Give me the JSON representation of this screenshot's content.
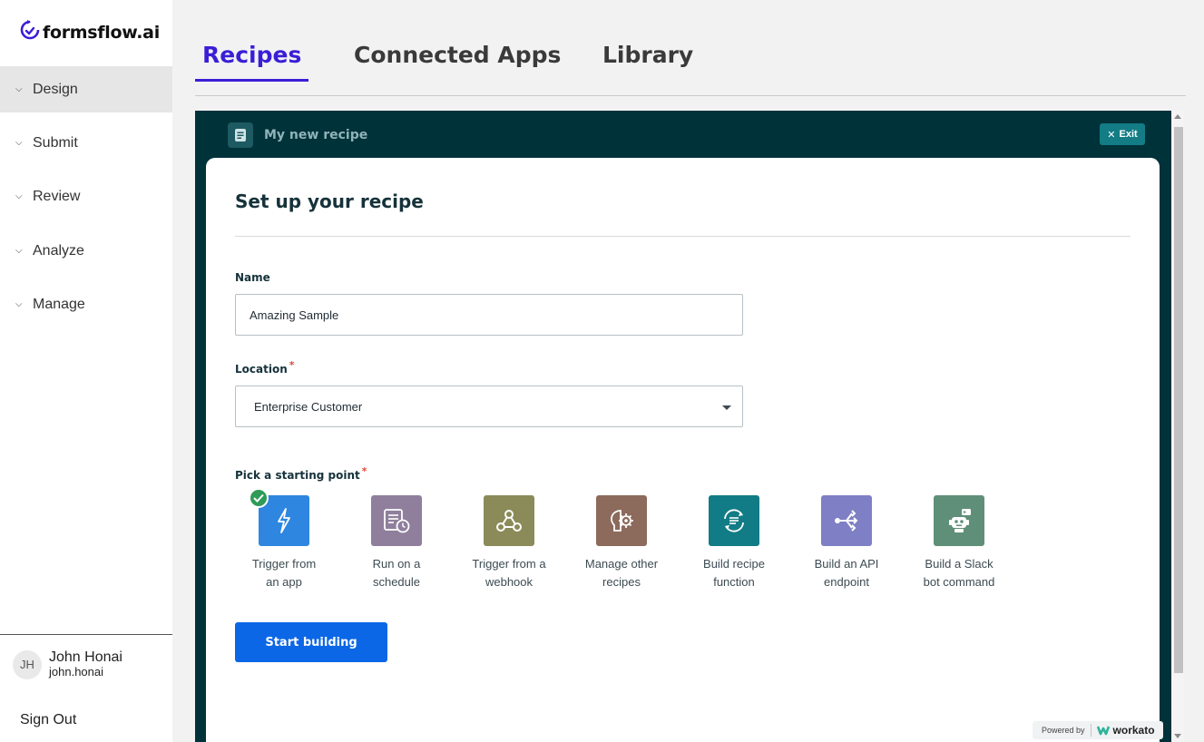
{
  "brand": {
    "name": "formsflow.ai"
  },
  "sidebar": {
    "items": [
      {
        "label": "Design",
        "icon": "chevron-down-icon"
      },
      {
        "label": "Submit",
        "icon": "chevron-down-icon"
      },
      {
        "label": "Review",
        "icon": "chevron-down-icon"
      },
      {
        "label": "Analyze",
        "icon": "chevron-down-icon"
      },
      {
        "label": "Manage",
        "icon": "chevron-down-icon"
      }
    ],
    "active": "Design"
  },
  "user": {
    "initials": "JH",
    "name": "John Honai",
    "username": "john.honai"
  },
  "signout_label": "Sign Out",
  "tabs": [
    {
      "label": "Recipes",
      "active": true
    },
    {
      "label": "Connected Apps",
      "active": false
    },
    {
      "label": "Library",
      "active": false
    }
  ],
  "recipe": {
    "title": "My new recipe",
    "exit_label": "Exit",
    "card_title": "Set up your recipe",
    "name_label": "Name",
    "name_value": "Amazing Sample",
    "location_label": "Location",
    "location_value": "Enterprise Customer",
    "required_mark": "*",
    "starting_point_label": "Pick a starting point",
    "starting_points": [
      {
        "line1": "Trigger from",
        "line2": "an app",
        "color": "#2f86e0",
        "icon": "lightning-icon",
        "selected": true
      },
      {
        "line1": "Run on a",
        "line2": "schedule",
        "color": "#8f7f9c",
        "icon": "schedule-icon",
        "selected": false
      },
      {
        "line1": "Trigger from a",
        "line2": "webhook",
        "color": "#8b8b5a",
        "icon": "webhook-icon",
        "selected": false
      },
      {
        "line1": "Manage other",
        "line2": "recipes",
        "color": "#8c6a5c",
        "icon": "brain-gear-icon",
        "selected": false
      },
      {
        "line1": "Build recipe",
        "line2": "function",
        "color": "#117c85",
        "icon": "function-icon",
        "selected": false
      },
      {
        "line1": "Build an API",
        "line2": "endpoint",
        "color": "#7f7fc6",
        "icon": "api-endpoint-icon",
        "selected": false
      },
      {
        "line1": "Build a Slack",
        "line2": "bot command",
        "color": "#5f8f78",
        "icon": "bot-icon",
        "selected": false
      }
    ],
    "start_button": "Start building"
  },
  "powered": {
    "prefix": "Powered by",
    "brand": "workato"
  },
  "colors": {
    "accent": "#3a1ed6",
    "frame_bg": "#00323a",
    "primary_button": "#0b67e6",
    "exit_button": "#137c85"
  }
}
